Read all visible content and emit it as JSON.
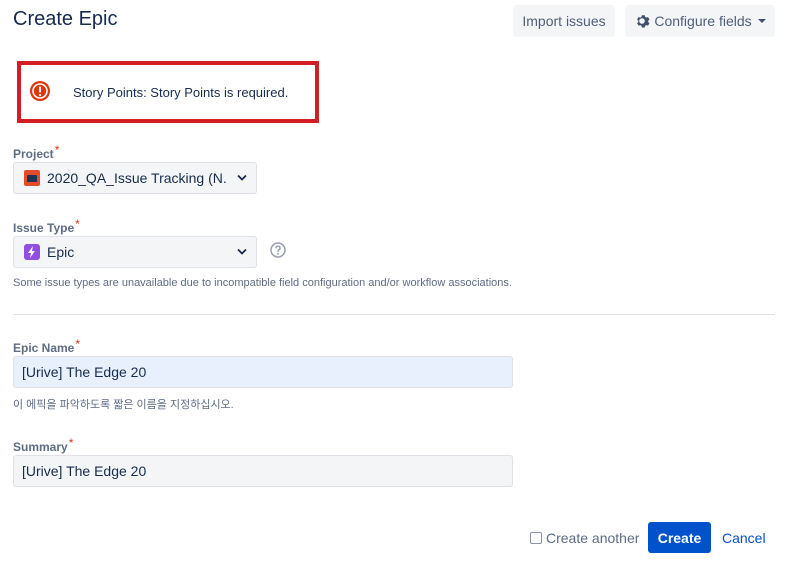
{
  "header": {
    "title": "Create Epic",
    "import_label": "Import issues",
    "configure_label": "Configure fields"
  },
  "error": {
    "message": "Story Points: Story Points is required."
  },
  "project": {
    "label": "Project",
    "required_mark": "*",
    "value": "2020_QA_Issue Tracking (N..."
  },
  "issue_type": {
    "label": "Issue Type",
    "required_mark": "*",
    "value": "Epic",
    "note": "Some issue types are unavailable due to incompatible field configuration and/or workflow associations."
  },
  "epic_name": {
    "label": "Epic Name",
    "required_mark": "*",
    "value": "[Urive] The Edge 20",
    "help": "이 에픽을 파악하도록 짧은 이름을 지정하십시오."
  },
  "summary": {
    "label": "Summary",
    "required_mark": "*",
    "value": "[Urive] The Edge 20"
  },
  "footer": {
    "create_another_label": "Create another",
    "create_another_checked": false,
    "create_label": "Create",
    "cancel_label": "Cancel"
  },
  "colors": {
    "error_border": "#d11f26",
    "primary": "#0052cc",
    "required": "#de350b",
    "epic_badge": "#904ee2"
  },
  "icons": {
    "error": "error-stop-icon",
    "configure": "gear-icon",
    "project": "project-avatar-icon",
    "epic": "lightning-bolt-icon",
    "help": "question-circle-icon"
  }
}
